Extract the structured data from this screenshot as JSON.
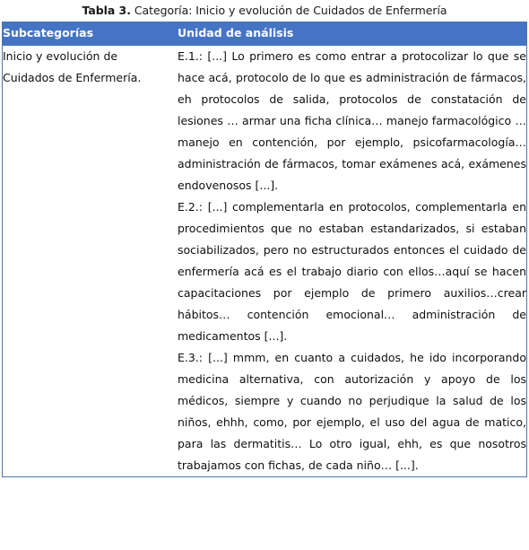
{
  "caption": {
    "label": "Tabla 3.",
    "text": " Categoría: Inicio y evolución de Cuidados de Enfermería"
  },
  "colors": {
    "header_background": "#4574c4",
    "header_text": "#ffffff",
    "table_border": "#4f76a8",
    "body_text": "#101010"
  },
  "table": {
    "headers": {
      "subcategories": "Subcategorías",
      "analysis_unit": "Unidad de análisis"
    },
    "rows": [
      {
        "subcategory_line_1": "Inicio y evolución de",
        "subcategory_line_2": "Cuidados de Enfermería.",
        "paragraphs": [
          "E.1.: [...] Lo primero es como entrar a protocolizar lo que se hace acá, protocolo de lo que es administración de fármacos, eh protocolos de salida, protocolos de constatación de lesiones … armar una ficha clínica… manejo farmacológico … manejo en contención, por ejemplo, psicofarmacología… administración de fármacos, tomar exámenes acá, exámenes endovenosos [...].",
          "E.2.: [...] complementarla en protocolos, complementarla en procedimientos que no estaban estandarizados, si estaban sociabilizados, pero no estructurados entonces el cuidado de enfermería acá es el trabajo diario con ellos…aquí se hacen capacitaciones por ejemplo de primero auxilios…crear hábitos… contención emocional… administración de medicamentos [...].",
          "E.3.: [...] mmm, en cuanto a cuidados, he ido incorporando medicina alternativa, con autorización y apoyo de los médicos, siempre y cuando no perjudique la salud de los niños, ehhh, como, por ejemplo, el uso del agua de matico, para las dermatitis… Lo otro igual, ehh, es que nosotros trabajamos con fichas, de cada niño… [...]."
        ]
      }
    ]
  }
}
